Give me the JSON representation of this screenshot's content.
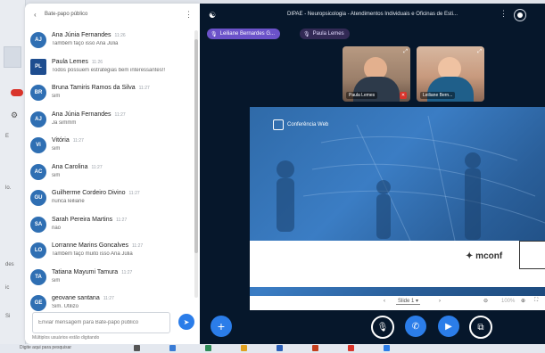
{
  "chat": {
    "title": "Bate-papo público",
    "messages": [
      {
        "initials": "AJ",
        "name": "Ana Júnia Fernandes",
        "time": "11:26",
        "text": "Também faço isso Ana Júlia"
      },
      {
        "initials": "PL",
        "name": "Paula Lemes",
        "time": "11:26",
        "text": "Todos possuem estratégias bem interessantes!!",
        "square": true
      },
      {
        "initials": "BR",
        "name": "Bruna Tamiris Ramos da Silva",
        "time": "11:27",
        "text": "sim"
      },
      {
        "initials": "AJ",
        "name": "Ana Júnia Fernandes",
        "time": "11:27",
        "text": "Ja simmm"
      },
      {
        "initials": "Vi",
        "name": "Vitória",
        "time": "11:27",
        "text": "sim"
      },
      {
        "initials": "AC",
        "name": "Ana Carolina",
        "time": "11:27",
        "text": "sim"
      },
      {
        "initials": "GU",
        "name": "Guilherme Cordeiro Divino",
        "time": "11:27",
        "text": "nunca leiliane"
      },
      {
        "initials": "SA",
        "name": "Sarah Pereira Martins",
        "time": "11:27",
        "text": "não"
      },
      {
        "initials": "LO",
        "name": "Lorranne Marins Goncalves",
        "time": "11:27",
        "text": "Também faço muito isso Ana Júlia"
      },
      {
        "initials": "TA",
        "name": "Tatiana Mayumi Tamura",
        "time": "11:27",
        "text": "sim"
      },
      {
        "initials": "GE",
        "name": "geovane santana",
        "time": "11:27",
        "text": "Sim. Utilizo"
      }
    ],
    "input_placeholder": "Enviar mensagem para Bate-papo público",
    "typing": "Múltiplos usuários estão digitando"
  },
  "meeting": {
    "title": "DIPAE - Neuropsicologia - Atendimentos Individuais e Oficinas de Esti...",
    "chips": [
      "Leiliane Bernardes G...",
      "Paula Lemes"
    ],
    "tiles": [
      "Paula Lemes",
      "Leiliane Bern..."
    ],
    "slide": {
      "brand_top": "Conferência Web",
      "brand_bottom": "mconf",
      "selector": "Slide 1",
      "zoom": "100%"
    }
  },
  "taskbar": {
    "search_text": "Digite aqui para pesquisar"
  },
  "colors": {
    "accent": "#2b7de9",
    "meeting_bg": "#06172b",
    "chip_active": "#6b52c9"
  }
}
